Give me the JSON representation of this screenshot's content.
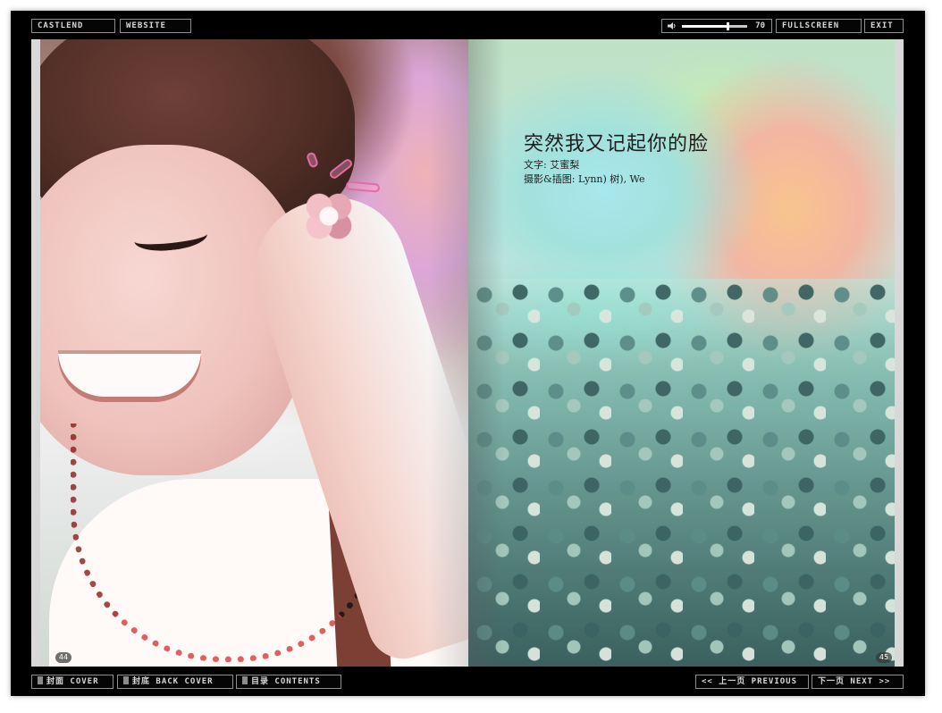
{
  "top_bar": {
    "brand_label": "CASTLEND",
    "website_label": "WEBSITE",
    "volume_value": "70",
    "volume_level_percent": 70,
    "fullscreen_label": "FULLSCREEN",
    "exit_label": "EXIT"
  },
  "book": {
    "left_page_number": "44",
    "right_page_number": "45",
    "article": {
      "title": "突然我又记起你的脸",
      "text_credit": "文字: 艾蜜梨",
      "photo_credit": "摄影&插图: Lynn) 树), We"
    }
  },
  "bottom_bar": {
    "cover_label": "封面 COVER",
    "back_cover_label": "封底 BACK COVER",
    "contents_label": "目录 CONTENTS",
    "previous_label": "<< 上一页 PREVIOUS",
    "next_label": "下一页 NEXT >>"
  },
  "icons": {
    "speaker": "speaker-icon",
    "square": "square-marker-icon"
  },
  "colors": {
    "chrome": "#000000",
    "button_border": "#8f8f8f",
    "button_text": "#d8d8d8"
  }
}
